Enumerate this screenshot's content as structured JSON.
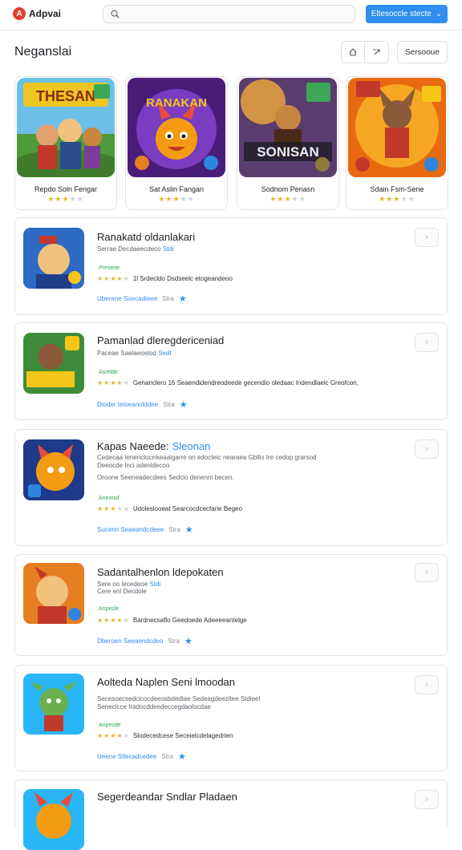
{
  "app": {
    "logo_text": "Adpvai"
  },
  "header": {
    "cta_label": "Eltesoccle stecte"
  },
  "page": {
    "title": "Neganslai",
    "sort_label": "Sersooue"
  },
  "featured": [
    {
      "name": "Repdo Soln Fengar",
      "rating": 3
    },
    {
      "name": "Sat Aslin Fangan",
      "rating": 3
    },
    {
      "name": "Sodnom Penasn",
      "rating": 3
    },
    {
      "name": "Sdain Fsm-Sene",
      "rating": 3
    }
  ],
  "featured_art": [
    {
      "banner": "THESAN"
    },
    {
      "banner": "RANAKAN"
    },
    {
      "banner": "SONISAN"
    },
    {
      "banner": ""
    }
  ],
  "list": [
    {
      "title": "Ranakatd oldanlakari",
      "tag": "",
      "sub1": "Serrae Decdaeecdeco",
      "sub1_tag": "Stdi",
      "sub2": "",
      "sub3": "",
      "green": "Presene",
      "rating": 4,
      "rating_text": "1l Srdecldo Dsdseelc etogeandeoo",
      "link": "Uberene Soecadieee",
      "link_tag": "Stra"
    },
    {
      "title": "Pamanlad dleregdericeniad",
      "tag": "",
      "sub1": "Paceae Saelaeoelod",
      "sub1_tag": "Sedt",
      "sub2": "",
      "sub3": "",
      "green": "Asrelde",
      "rating": 4,
      "rating_text": "Genanclero 16 Seaendidendreodeede gecendio oledaac Indendlaelc Greofcon,",
      "link": "Dioder Ieioeannlddee",
      "link_tag": "Stra"
    },
    {
      "title": "Kapas Naeede:",
      "tag": "Sleonan",
      "sub1": "Cedecaa Ienenclocrrkeaalgarre on edocteic nearaea Gbllis Ire cedop grarsod",
      "sub1_tag": "",
      "sub2": "Deeocde Inci adenldecoo",
      "sub3": "Oroone Seeneadecdees Sedcio denenm becen.",
      "green": "Aneonsf",
      "rating": 3,
      "rating_text": "Udolesiooeat Searcocdcecfarie Begeo",
      "link": "Sucenn Seaeandcdeee",
      "link_tag": "Stra"
    },
    {
      "title": "Sadantalhenlon ldepokaten",
      "tag": "",
      "sub1": "Sere oo Iecedeoe",
      "sub1_tag": "Stdi",
      "sub2": "Cere enl Decdole",
      "sub3": "",
      "green": "Anpecle",
      "rating": 4,
      "rating_text": "Bardnecsaflo Geedoede Adeeeeantelge",
      "link": "Dberoen Seeaendcdeo",
      "link_tag": "Stra"
    },
    {
      "title": "Aolteda Naplen Seni lmoodan",
      "tag": "",
      "sub1": "Secesoecsedcicocdeeosbdedlae Sedeagdeezitee Stdieel",
      "sub1_tag": "",
      "sub2": "Seneclcce Iradocddeedeccegdaolocdae",
      "sub3": "",
      "green": "Anpecde",
      "rating": 4,
      "rating_text": "Slodecedcese Seceielcdelagedrien",
      "link": "Ueene Stlecadcedee",
      "link_tag": "Stra"
    },
    {
      "title": "Segerdeandar Sndlar Pladaen",
      "tag": "",
      "sub1": "",
      "sub1_tag": "",
      "sub2": "",
      "sub3": "",
      "green": "",
      "rating": 0,
      "rating_text": "",
      "link": "",
      "link_tag": ""
    }
  ]
}
